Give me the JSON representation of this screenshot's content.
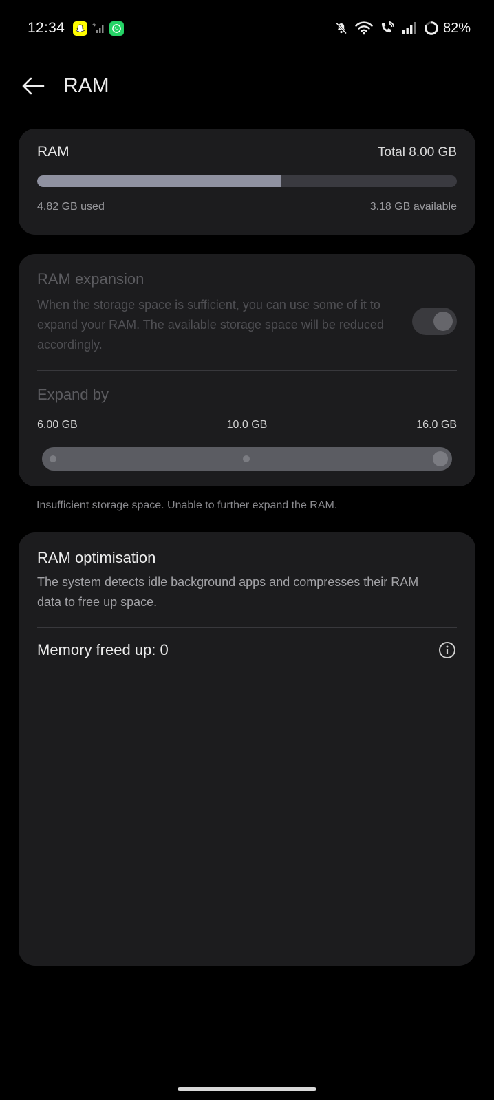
{
  "status_bar": {
    "time": "12:34",
    "battery": "82%",
    "icons": [
      "snapchat-icon",
      "no-signal-sim-icon",
      "whatsapp-icon",
      "mute-bell-icon",
      "wifi-icon",
      "wifi-calling-icon",
      "signal-icon",
      "battery-ring-icon"
    ]
  },
  "header": {
    "title": "RAM"
  },
  "ram_card": {
    "title": "RAM",
    "total": "Total 8.00 GB",
    "used_label": "4.82 GB used",
    "available_label": "3.18 GB available",
    "used_fraction": 0.58
  },
  "expansion_card": {
    "title": "RAM expansion",
    "description": "When the storage space is sufficient, you can use some of it to expand your RAM. The available storage space will be reduced accordingly.",
    "toggle_on": false,
    "expand_title": "Expand by",
    "ticks": [
      "6.00 GB",
      "10.0 GB",
      "16.0 GB"
    ],
    "slider_selected": "16.0 GB"
  },
  "note": "Insufficient storage space. Unable to further expand the RAM.",
  "optimisation_card": {
    "title": "RAM optimisation",
    "description": "The system detects idle background apps and compresses their RAM data to free up space.",
    "memory_freed": "Memory freed up: 0"
  },
  "colors": {
    "background": "#000000",
    "card": "#1c1c1e",
    "bar_fill": "#8f91a0",
    "bar_track": "#3a3a40"
  }
}
